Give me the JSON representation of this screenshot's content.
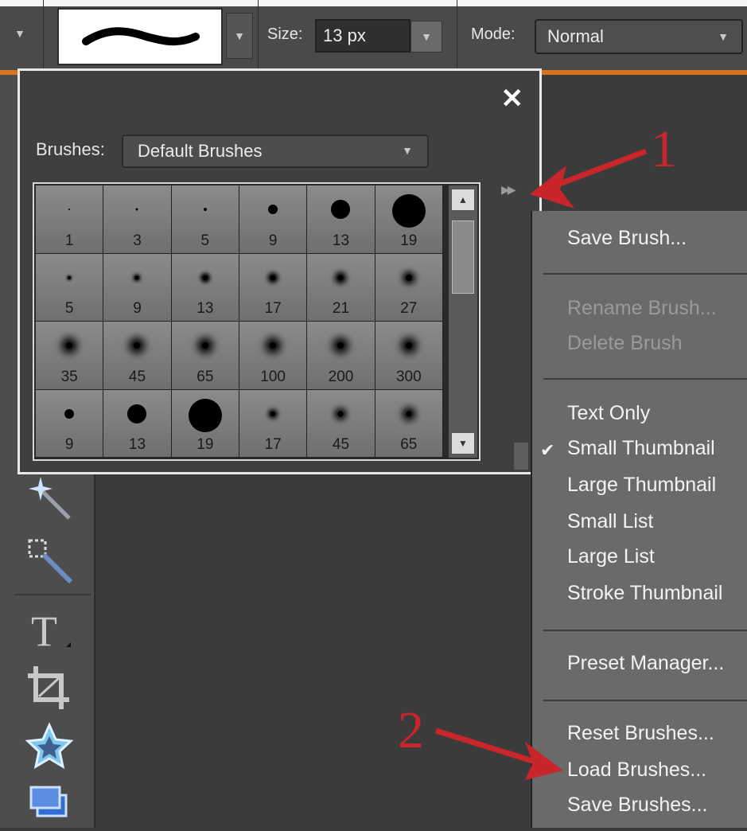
{
  "options_bar": {
    "size_label": "Size:",
    "size_value": "13 px",
    "mode_label": "Mode:",
    "mode_value": "Normal"
  },
  "picker": {
    "close_glyph": "✕",
    "brushes_label": "Brushes:",
    "brush_set": "Default Brushes",
    "brushes": [
      {
        "size": "1"
      },
      {
        "size": "3"
      },
      {
        "size": "5"
      },
      {
        "size": "9"
      },
      {
        "size": "13"
      },
      {
        "size": "19"
      },
      {
        "size": "5"
      },
      {
        "size": "9"
      },
      {
        "size": "13"
      },
      {
        "size": "17"
      },
      {
        "size": "21"
      },
      {
        "size": "27"
      },
      {
        "size": "35"
      },
      {
        "size": "45"
      },
      {
        "size": "65"
      },
      {
        "size": "100"
      },
      {
        "size": "200"
      },
      {
        "size": "300"
      },
      {
        "size": "9"
      },
      {
        "size": "13"
      },
      {
        "size": "19"
      },
      {
        "size": "17"
      },
      {
        "size": "45"
      },
      {
        "size": "65"
      }
    ]
  },
  "menu": {
    "save_brush": "Save Brush...",
    "rename_brush": "Rename Brush...",
    "delete_brush": "Delete Brush",
    "text_only": "Text Only",
    "small_thumbnail": "Small Thumbnail",
    "large_thumbnail": "Large Thumbnail",
    "small_list": "Small List",
    "large_list": "Large List",
    "stroke_thumbnail": "Stroke Thumbnail",
    "preset_manager": "Preset Manager...",
    "reset_brushes": "Reset Brushes...",
    "load_brushes": "Load Brushes...",
    "save_brushes": "Save Brushes...",
    "checked_item": "Small Thumbnail"
  },
  "annotations": {
    "marker_1": "1",
    "marker_2": "2"
  },
  "colors": {
    "accent_orange": "#d9731f",
    "annotation_red": "#c8262b"
  }
}
